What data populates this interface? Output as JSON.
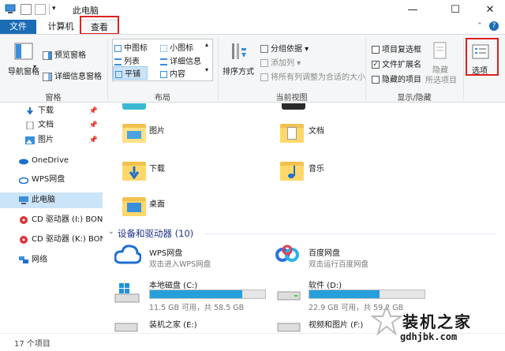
{
  "window": {
    "title": "此电脑",
    "minimize": "—",
    "maximize": "☐",
    "close": "✕"
  },
  "tabs": {
    "file": "文件",
    "computer": "计算机",
    "view": "查看"
  },
  "ribbon": {
    "panes": {
      "nav_pane": "导航窗格",
      "preview": "预览窗格",
      "details": "详细信息窗格",
      "label": "窗格"
    },
    "layout": {
      "medium": "中图标",
      "small": "小图标",
      "list": "列表",
      "details": "详细信息",
      "tiles": "平铺",
      "content": "内容",
      "label": "布局"
    },
    "current_view": {
      "sort": "排序方式",
      "group_by": "分组依据",
      "add_column": "添加列",
      "size_all": "将所有列调整为合适的大小",
      "label": "当前视图"
    },
    "show_hide": {
      "item_checkbox": "项目复选框",
      "extensions": "文件扩展名",
      "hidden_items": "隐藏的项目",
      "hide": "隐藏",
      "hide_selected": "所选项目",
      "label": "显示/隐藏"
    },
    "options": "选项",
    "checkboxes": {
      "item_checkbox": false,
      "extensions": true,
      "hidden_items": false
    }
  },
  "nav": {
    "items": [
      {
        "label": "下载",
        "pinned": "📌"
      },
      {
        "label": "文档",
        "pinned": "📌"
      },
      {
        "label": "图片",
        "pinned": "📌"
      },
      {
        "label": "OneDrive"
      },
      {
        "label": "WPS网盘"
      },
      {
        "label": "此电脑"
      },
      {
        "label": "CD 驱动器 (I:) BON/"
      },
      {
        "label": "CD 驱动器 (K:) BON"
      },
      {
        "label": "网络"
      }
    ]
  },
  "folders": [
    {
      "label": "图片"
    },
    {
      "label": "文档"
    },
    {
      "label": "下载"
    },
    {
      "label": "音乐"
    },
    {
      "label": "桌面"
    }
  ],
  "devices": {
    "heading": "设备和驱动器 (10)",
    "cloud": [
      {
        "name": "WPS网盘",
        "sub": "双击进入WPS网盘"
      },
      {
        "name": "百度网盘",
        "sub": "双击运行百度网盘"
      }
    ],
    "drives": [
      {
        "name": "本地磁盘 (C:)",
        "sub": "11.5 GB 可用，共 58.5 GB",
        "used_fraction": 0.8
      },
      {
        "name": "软件 (D:)",
        "sub": "22.9 GB 可用，共 59.2 GB",
        "used_fraction": 0.61
      },
      {
        "name": "装机之家 (E:)"
      },
      {
        "name": "视频和图片 (F:)"
      }
    ]
  },
  "status": {
    "count": "17 个项目"
  },
  "watermark": {
    "name": "装机之家",
    "url": "gdhjbk.com"
  },
  "colors": {
    "accent": "#1b6cb5",
    "highlight": "#e02020",
    "drive_fill": "#26a0da",
    "folder": "#ffd76b"
  }
}
